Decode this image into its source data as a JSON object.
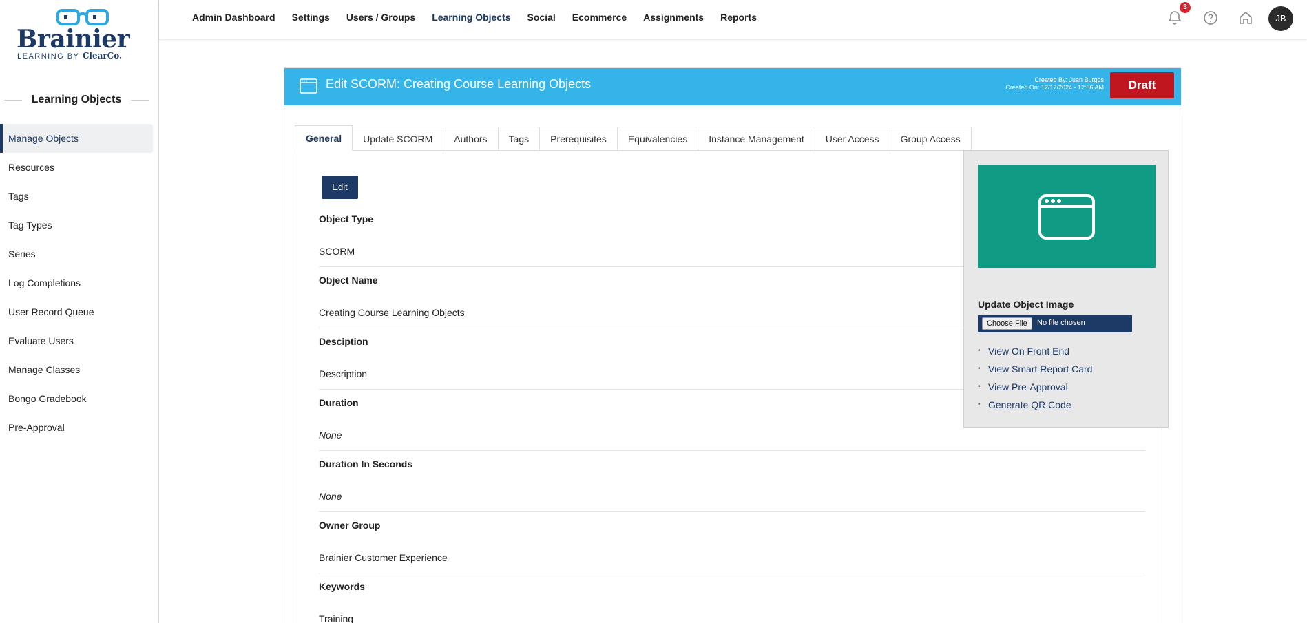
{
  "brand": {
    "name": "Brainier",
    "tagline": "LEARNING BY",
    "tagline_brand": "ClearCo."
  },
  "sidebar": {
    "title": "Learning Objects",
    "items": [
      {
        "label": "Manage Objects"
      },
      {
        "label": "Resources"
      },
      {
        "label": "Tags"
      },
      {
        "label": "Tag Types"
      },
      {
        "label": "Series"
      },
      {
        "label": "Log Completions"
      },
      {
        "label": "User Record Queue"
      },
      {
        "label": "Evaluate Users"
      },
      {
        "label": "Manage Classes"
      },
      {
        "label": "Bongo Gradebook"
      },
      {
        "label": "Pre-Approval"
      }
    ]
  },
  "topnav": {
    "items": [
      {
        "label": "Admin Dashboard"
      },
      {
        "label": "Settings"
      },
      {
        "label": "Users / Groups"
      },
      {
        "label": "Learning Objects"
      },
      {
        "label": "Social"
      },
      {
        "label": "Ecommerce"
      },
      {
        "label": "Assignments"
      },
      {
        "label": "Reports"
      }
    ],
    "active": "Learning Objects",
    "notification_count": "3",
    "avatar_initials": "JB"
  },
  "header": {
    "title": "Edit SCORM: Creating Course Learning Objects",
    "created_by": "Created By: Juan Burgos",
    "created_on": "Created On: 12/17/2024 - 12:56 AM",
    "status_button": "Draft",
    "status_color": "#c0161f",
    "accent_color": "#34b4e8"
  },
  "tabs": [
    {
      "label": "General"
    },
    {
      "label": "Update SCORM"
    },
    {
      "label": "Authors"
    },
    {
      "label": "Tags"
    },
    {
      "label": "Prerequisites"
    },
    {
      "label": "Equivalencies"
    },
    {
      "label": "Instance Management"
    },
    {
      "label": "User Access"
    },
    {
      "label": "Group Access"
    }
  ],
  "general": {
    "edit_label": "Edit",
    "fields": [
      {
        "label": "Object Type",
        "value": "SCORM"
      },
      {
        "label": "Object Name",
        "value": "Creating Course Learning Objects"
      },
      {
        "label": "Desciption",
        "value": "Description"
      },
      {
        "label": "Duration",
        "value": "None"
      },
      {
        "label": "Duration In Seconds",
        "value": "None"
      },
      {
        "label": "Owner Group",
        "value": "Brainier Customer Experience"
      },
      {
        "label": "Keywords",
        "value": "Training"
      }
    ]
  },
  "panel": {
    "image_color": "#0f9b84",
    "update_label": "Update Object Image",
    "choose_file": "Choose File",
    "no_file": "No file chosen",
    "links": [
      {
        "label": "View On Front End"
      },
      {
        "label": "View Smart Report Card"
      },
      {
        "label": "View Pre-Approval"
      },
      {
        "label": "Generate QR Code"
      }
    ]
  },
  "icons": {
    "header": "window-icon",
    "notification": "bell-icon",
    "help": "help-circle-icon",
    "home": "home-icon",
    "object_image": "browser-window-icon"
  }
}
